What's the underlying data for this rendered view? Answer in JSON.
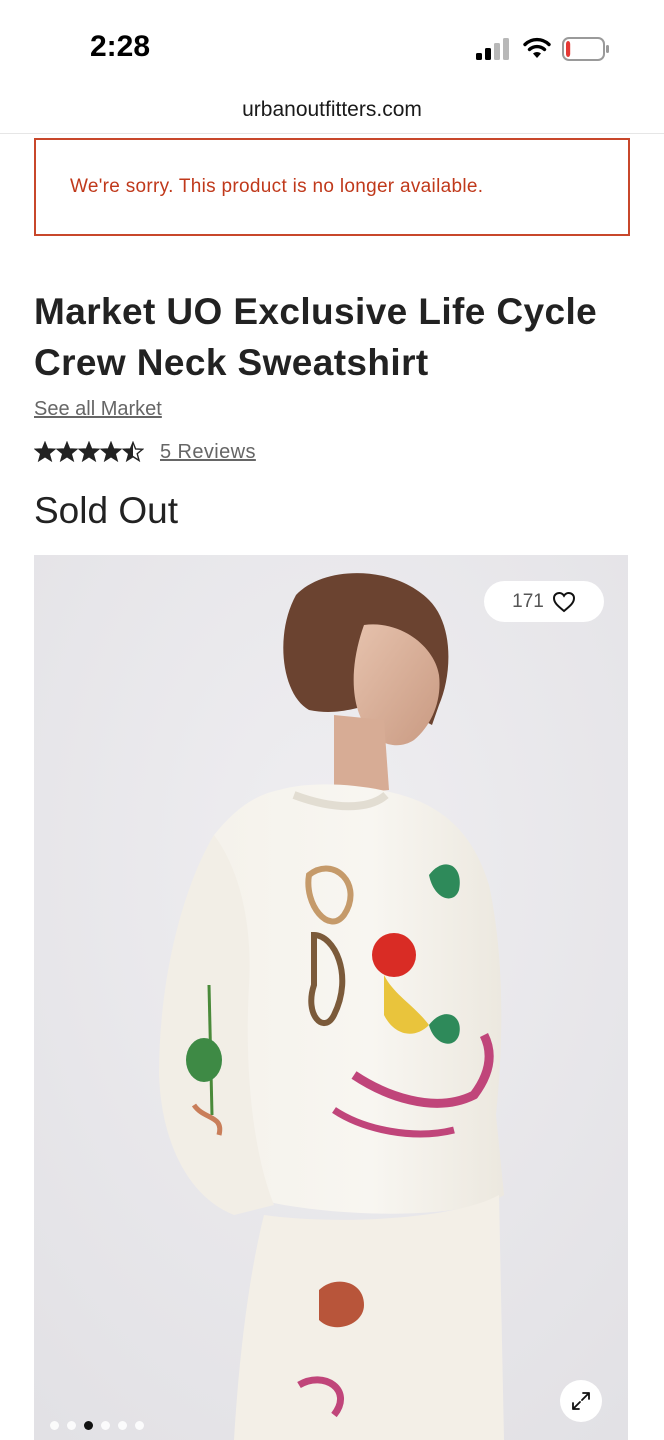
{
  "status_bar": {
    "time": "2:28",
    "signal_icon": "cellular-signal-icon",
    "wifi_icon": "wifi-icon",
    "battery_icon": "battery-low-icon",
    "battery_level": 0.12,
    "battery_color": "#e53935"
  },
  "browser": {
    "url": "urbanoutfitters.com"
  },
  "alert": {
    "message": "We're sorry. This product is no longer available.",
    "border_color": "#c8472b",
    "text_color": "#c0391b"
  },
  "product": {
    "title": "Market UO Exclusive Life Cycle Crew Neck Sweatshirt",
    "brand_link": "See all Market",
    "rating": 4.5,
    "rating_max": 5,
    "reviews_link": "5 Reviews",
    "availability": "Sold Out"
  },
  "gallery": {
    "favorites_count": "171",
    "favorite_icon": "heart-outline-icon",
    "expand_icon": "expand-arrows-icon",
    "slide_count": 6,
    "active_slide": 3
  }
}
